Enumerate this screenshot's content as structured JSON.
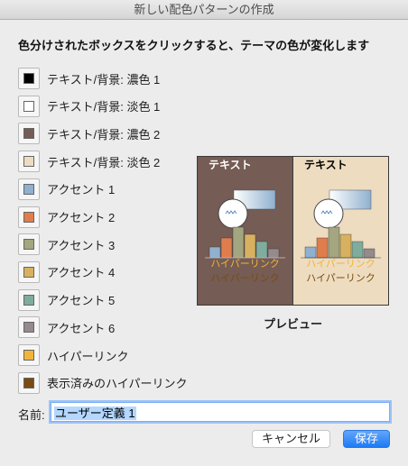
{
  "window": {
    "title": "新しい配色パターンの作成"
  },
  "instruction": "色分けされたボックスをクリックすると、テーマの色が変化します",
  "color_rows": [
    {
      "label": "テキスト/背景: 濃色 1",
      "color": "#000000"
    },
    {
      "label": "テキスト/背景: 淡色 1",
      "color": "#ffffff"
    },
    {
      "label": "テキスト/背景: 濃色 2",
      "color": "#755c54"
    },
    {
      "label": "テキスト/背景: 淡色 2",
      "color": "#eddcc0"
    },
    {
      "label": "アクセント 1",
      "color": "#8fb0cf"
    },
    {
      "label": "アクセント 2",
      "color": "#e07d4d"
    },
    {
      "label": "アクセント 3",
      "color": "#a3a67e"
    },
    {
      "label": "アクセント 4",
      "color": "#d7b15f"
    },
    {
      "label": "アクセント 5",
      "color": "#7fac9c"
    },
    {
      "label": "アクセント 6",
      "color": "#958a8c"
    },
    {
      "label": "ハイパーリンク",
      "color": "#f2b53a"
    },
    {
      "label": "表示済みのハイパーリンク",
      "color": "#7a4b12"
    }
  ],
  "preview": {
    "caption": "プレビュー",
    "panels": [
      {
        "text": "テキスト",
        "link": "ハイパーリンク",
        "visited": "ハイパーリンク",
        "background": "#755c54",
        "text_color": "#ffffff"
      },
      {
        "text": "テキスト",
        "link": "ハイパーリンク",
        "visited": "ハイパーリンク",
        "background": "#eddcc0",
        "text_color": "#000000"
      }
    ]
  },
  "name_field": {
    "label": "名前:",
    "value": "ユーザー定義 1"
  },
  "buttons": {
    "cancel": "キャンセル",
    "save": "保存"
  }
}
